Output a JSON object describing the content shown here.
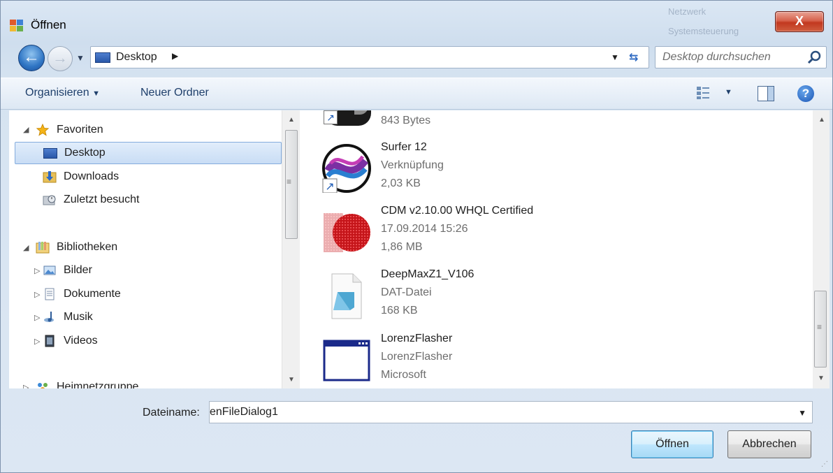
{
  "window": {
    "title": "Öffnen",
    "close_label": "X"
  },
  "background_items": [
    "Netzwerk",
    "Systemsteuerung"
  ],
  "address": {
    "location": "Desktop",
    "search_placeholder": "Desktop durchsuchen"
  },
  "commands": {
    "organize": "Organisieren",
    "new_folder": "Neuer Ordner",
    "help": "?"
  },
  "navtree": {
    "favorites": "Favoriten",
    "favorites_items": [
      "Desktop",
      "Downloads",
      "Zuletzt besucht"
    ],
    "libraries": "Bibliotheken",
    "libraries_items": [
      "Bilder",
      "Dokumente",
      "Musik",
      "Videos"
    ],
    "homegroup": "Heimnetzgruppe"
  },
  "files": [
    {
      "name": "",
      "line1": "843 Bytes",
      "line2": "",
      "icon": "shortcut-app-icon"
    },
    {
      "name": "Surfer 12",
      "line1": "Verknüpfung",
      "line2": "2,03 KB",
      "icon": "surfer-shortcut-icon"
    },
    {
      "name": "CDM v2.10.00 WHQL Certified",
      "line1": "17.09.2014 15:26",
      "line2": "1,86 MB",
      "icon": "cdm-installer-icon"
    },
    {
      "name": "DeepMaxZ1_V106",
      "line1": "DAT-Datei",
      "line2": "168 KB",
      "icon": "dat-file-icon"
    },
    {
      "name": "LorenzFlasher",
      "line1": "LorenzFlasher",
      "line2": "Microsoft",
      "icon": "application-window-icon"
    }
  ],
  "filename": {
    "label": "Dateiname:",
    "value": "enFileDialog1"
  },
  "buttons": {
    "open": "Öffnen",
    "cancel": "Abbrechen"
  },
  "colors": {
    "accent": "#3c7fb1",
    "close": "#c2381f",
    "selection": "#c9ddf5"
  }
}
